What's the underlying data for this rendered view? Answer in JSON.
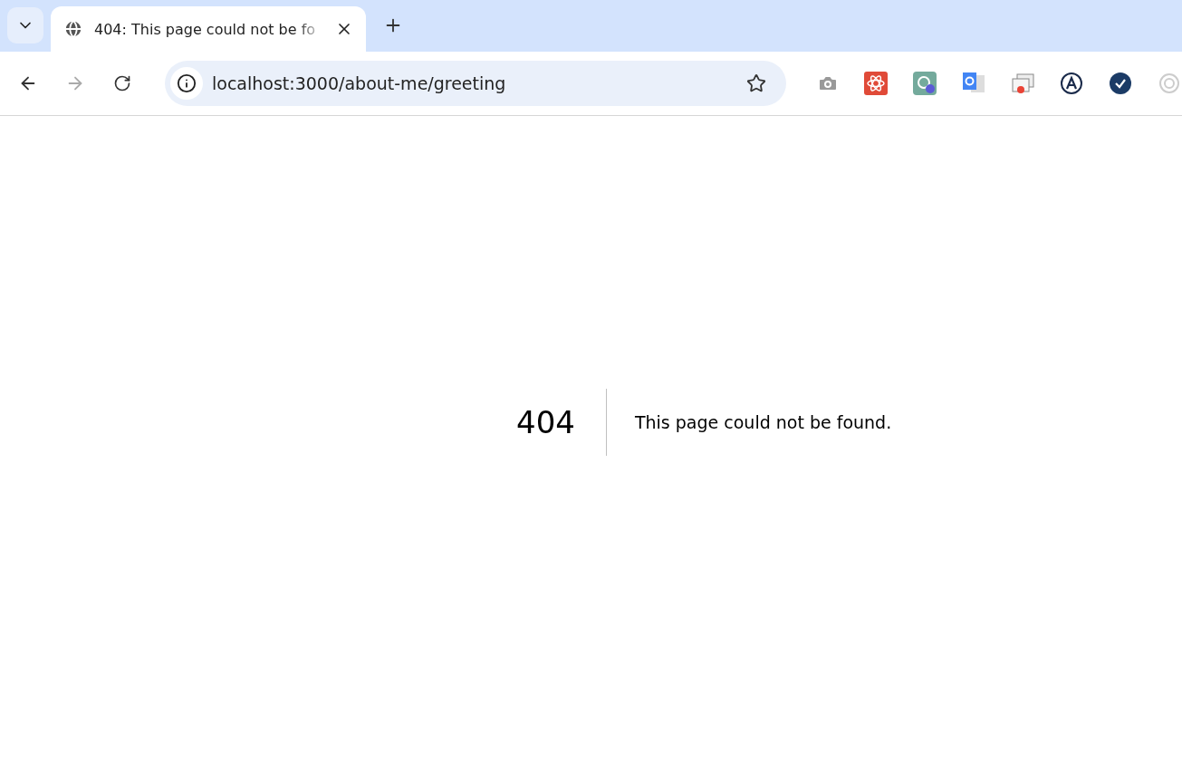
{
  "tab": {
    "title": "404: This page could not be fo",
    "selected": true
  },
  "nav": {
    "back_disabled": false,
    "forward_disabled": true
  },
  "address": {
    "url": "localhost:3000/about-me/greeting"
  },
  "extensions": [
    {
      "kind": "camera"
    },
    {
      "kind": "react"
    },
    {
      "kind": "gpt"
    },
    {
      "kind": "translate"
    },
    {
      "kind": "windows"
    },
    {
      "kind": "letter"
    },
    {
      "kind": "check"
    },
    {
      "kind": "ring"
    }
  ],
  "error": {
    "code": "404",
    "message": "This page could not be found."
  }
}
